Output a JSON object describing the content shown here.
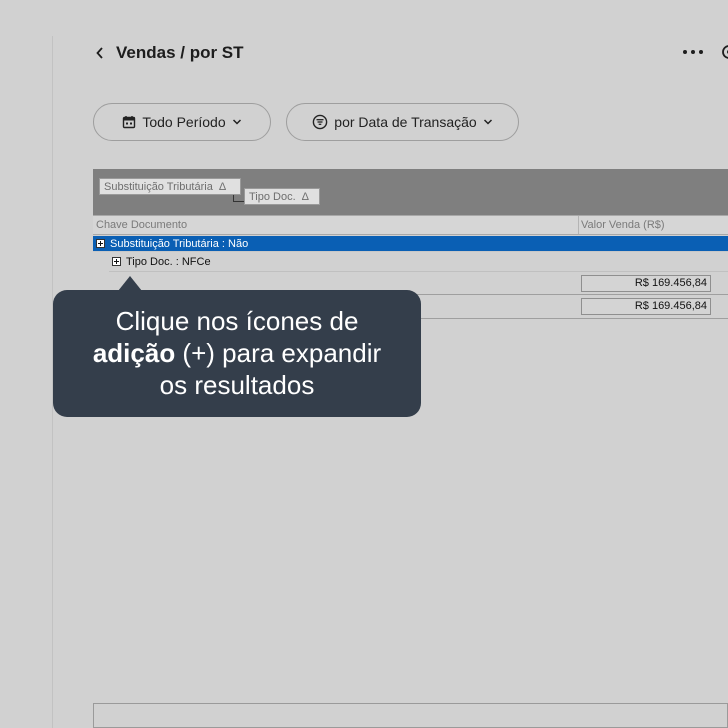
{
  "header": {
    "title": "Vendas / por ST",
    "back_icon": "chevron-left-icon",
    "more_icon": "more-horizontal-icon"
  },
  "filters": {
    "period_label": "Todo Período",
    "period_icon": "calendar-icon",
    "date_label": "por Data de Transação",
    "date_icon": "filter-lines-icon"
  },
  "pivot": {
    "row_fields": [
      {
        "label": "Substituição Tributária",
        "sort": "Δ"
      },
      {
        "label": "Tipo Doc.",
        "sort": "Δ"
      }
    ],
    "columns": [
      "Chave Documento",
      "Valor Venda (R$)"
    ],
    "groups": [
      {
        "label": "Substituição Tributária : Não",
        "selected": true
      },
      {
        "label": "Tipo Doc. : NFCe",
        "selected": false
      }
    ],
    "totals": [
      "R$ 169.456,84",
      "R$ 169.456,84"
    ]
  },
  "tooltip": {
    "line1": "Clique nos ícones de",
    "bold": "adição",
    "line2_rest": " (+) para expandir",
    "line3": "os resultados"
  },
  "colors": {
    "background": "#d1d1d1",
    "selection": "#0a5fb4",
    "tooltip": "#343e4b",
    "grid_header": "#7f7f7f"
  }
}
